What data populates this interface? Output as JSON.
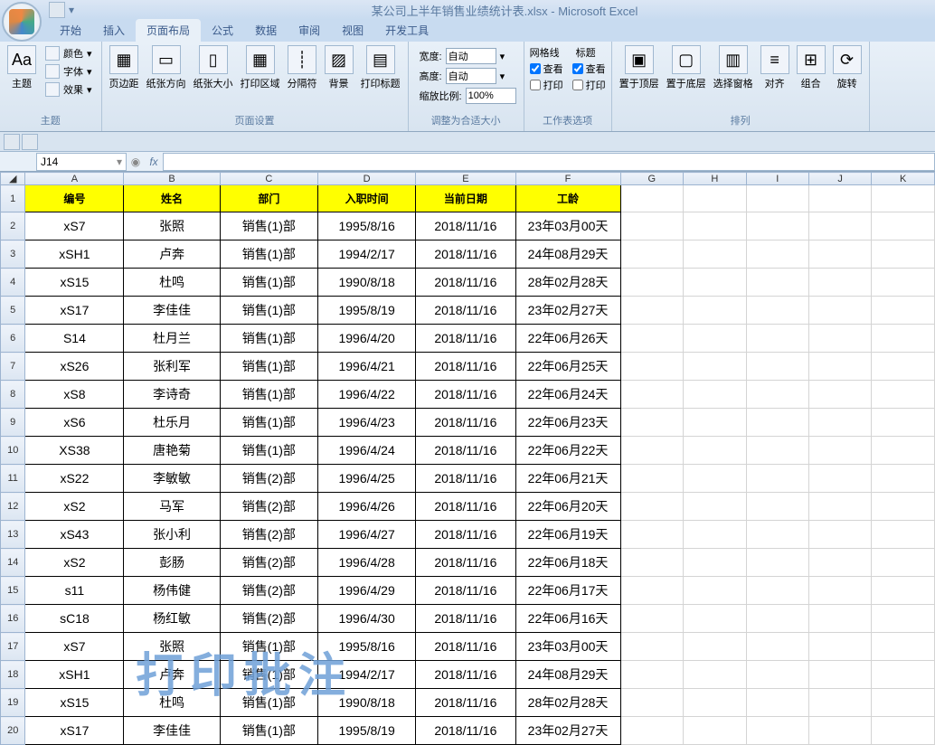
{
  "window": {
    "title": "某公司上半年销售业绩统计表.xlsx - Microsoft Excel"
  },
  "tabs": [
    "开始",
    "插入",
    "页面布局",
    "公式",
    "数据",
    "审阅",
    "视图",
    "开发工具"
  ],
  "ribbon": {
    "theme": {
      "label": "主题",
      "btns": {
        "label": "主题"
      },
      "colors": "颜色",
      "fonts": "字体",
      "effects": "效果"
    },
    "page_setup": {
      "label": "页面设置",
      "margins": "页边距",
      "orientation": "纸张方向",
      "size": "纸张大小",
      "print_area": "打印区域",
      "breaks": "分隔符",
      "background": "背景",
      "titles": "打印标题"
    },
    "scale": {
      "label": "调整为合适大小",
      "width": "宽度:",
      "height": "高度:",
      "ratio": "缩放比例:",
      "auto": "自动",
      "pct": "100%"
    },
    "sheet_opts": {
      "label": "工作表选项",
      "gridlines": "网格线",
      "headings": "标题",
      "view": "查看",
      "print": "打印"
    },
    "arrange": {
      "label": "排列",
      "front": "置于顶层",
      "back": "置于底层",
      "pane": "选择窗格",
      "align": "对齐",
      "group": "组合",
      "rotate": "旋转"
    }
  },
  "cell_ref": "J14",
  "columns": [
    "A",
    "B",
    "C",
    "D",
    "E",
    "F",
    "G",
    "H",
    "I",
    "J",
    "K"
  ],
  "headers": [
    "编号",
    "姓名",
    "部门",
    "入职时间",
    "当前日期",
    "工龄"
  ],
  "rows": [
    [
      "xS7",
      "张照",
      "销售(1)部",
      "1995/8/16",
      "2018/11/16",
      "23年03月00天"
    ],
    [
      "xSH1",
      "卢奔",
      "销售(1)部",
      "1994/2/17",
      "2018/11/16",
      "24年08月29天"
    ],
    [
      "xS15",
      "杜鸣",
      "销售(1)部",
      "1990/8/18",
      "2018/11/16",
      "28年02月28天"
    ],
    [
      "xS17",
      "李佳佳",
      "销售(1)部",
      "1995/8/19",
      "2018/11/16",
      "23年02月27天"
    ],
    [
      "S14",
      "杜月兰",
      "销售(1)部",
      "1996/4/20",
      "2018/11/16",
      "22年06月26天"
    ],
    [
      "xS26",
      "张利军",
      "销售(1)部",
      "1996/4/21",
      "2018/11/16",
      "22年06月25天"
    ],
    [
      "xS8",
      "李诗奇",
      "销售(1)部",
      "1996/4/22",
      "2018/11/16",
      "22年06月24天"
    ],
    [
      "xS6",
      "杜乐月",
      "销售(1)部",
      "1996/4/23",
      "2018/11/16",
      "22年06月23天"
    ],
    [
      "XS38",
      "唐艳菊",
      "销售(1)部",
      "1996/4/24",
      "2018/11/16",
      "22年06月22天"
    ],
    [
      "xS22",
      "李敏敏",
      "销售(2)部",
      "1996/4/25",
      "2018/11/16",
      "22年06月21天"
    ],
    [
      "xS2",
      "马军",
      "销售(2)部",
      "1996/4/26",
      "2018/11/16",
      "22年06月20天"
    ],
    [
      "xS43",
      "张小利",
      "销售(2)部",
      "1996/4/27",
      "2018/11/16",
      "22年06月19天"
    ],
    [
      "xS2",
      "彭肠",
      "销售(2)部",
      "1996/4/28",
      "2018/11/16",
      "22年06月18天"
    ],
    [
      "s11",
      "杨伟健",
      "销售(2)部",
      "1996/4/29",
      "2018/11/16",
      "22年06月17天"
    ],
    [
      "sC18",
      "杨红敏",
      "销售(2)部",
      "1996/4/30",
      "2018/11/16",
      "22年06月16天"
    ],
    [
      "xS7",
      "张照",
      "销售(1)部",
      "1995/8/16",
      "2018/11/16",
      "23年03月00天"
    ],
    [
      "xSH1",
      "卢奔",
      "销售(1)部",
      "1994/2/17",
      "2018/11/16",
      "24年08月29天"
    ],
    [
      "xS15",
      "杜鸣",
      "销售(1)部",
      "1990/8/18",
      "2018/11/16",
      "28年02月28天"
    ],
    [
      "xS17",
      "李佳佳",
      "销售(1)部",
      "1995/8/19",
      "2018/11/16",
      "23年02月27天"
    ]
  ],
  "watermark": "打印批注"
}
